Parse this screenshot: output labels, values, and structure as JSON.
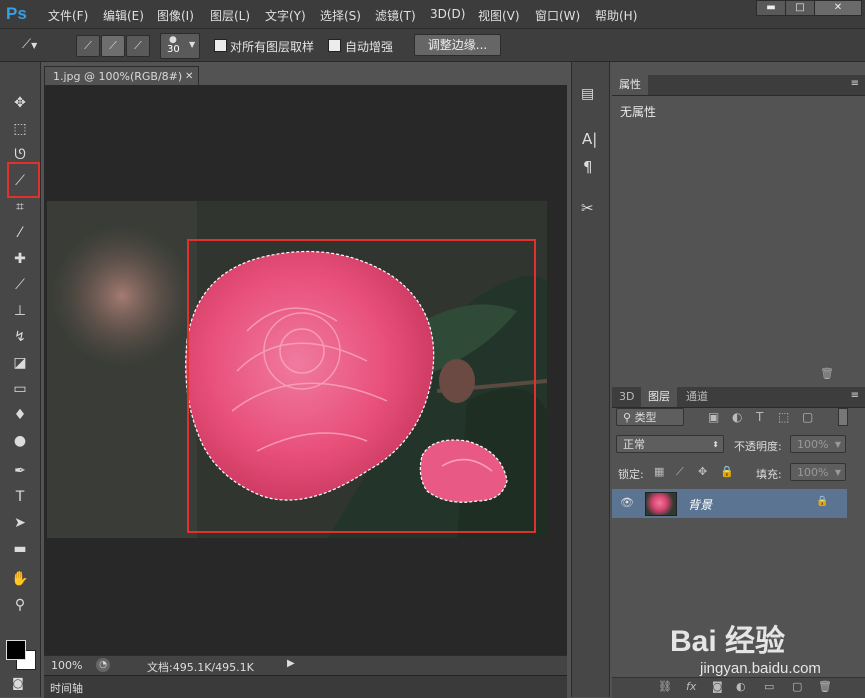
{
  "app": {
    "logo": "Ps"
  },
  "menu": [
    "文件(F)",
    "编辑(E)",
    "图像(I)",
    "图层(L)",
    "文字(Y)",
    "选择(S)",
    "滤镜(T)",
    "3D(D)",
    "视图(V)",
    "窗口(W)",
    "帮助(H)"
  ],
  "options": {
    "brush_size": "30",
    "sample_all_label": "对所有图层取样",
    "auto_enhance_label": "自动增强",
    "refine_edge_label": "调整边缘..."
  },
  "document": {
    "tab_title": "1.jpg @ 100%(RGB/8#)",
    "zoom": "100%",
    "doc_info": "文档:495.1K/495.1K",
    "timeline_label": "时间轴"
  },
  "properties": {
    "tab_label": "属性",
    "empty_text": "无属性"
  },
  "layers": {
    "tabs": [
      "3D",
      "图层",
      "通道"
    ],
    "filter_label": "类型",
    "blend_mode": "正常",
    "opacity_label": "不透明度:",
    "opacity_value": "100%",
    "lock_label": "锁定:",
    "fill_label": "填充:",
    "fill_value": "100%",
    "layer_name": "背景"
  },
  "watermark": {
    "brand": "Bai 经验",
    "url": "jingyan.baidu.com"
  },
  "colors": {
    "selection_box": "#e0312e",
    "ps_blue": "#3a9fe0",
    "flower_pink": "#e8507a",
    "layer_selected": "#5a7491"
  }
}
